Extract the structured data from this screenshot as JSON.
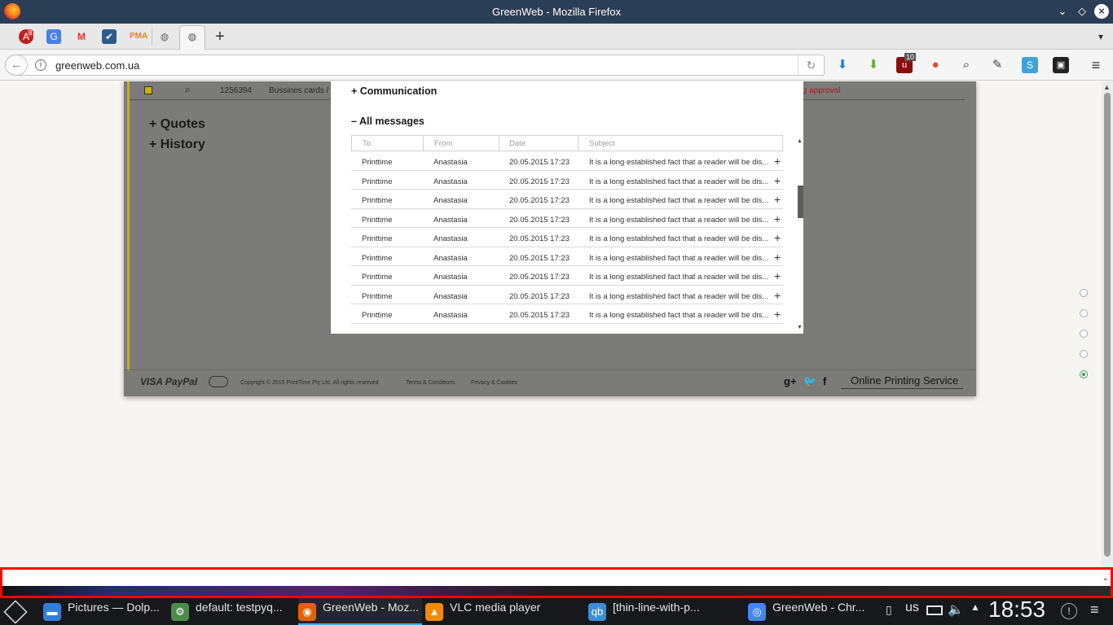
{
  "window": {
    "title": "GreenWeb - Mozilla Firefox"
  },
  "tabbar": {
    "pinned_icons": [
      "adblock-icon",
      "google-translate-icon",
      "gmail-icon",
      "task-icon",
      "pma-icon",
      "globe-icon"
    ],
    "active_tab_icon": "globe-icon",
    "new_tab": "+",
    "overflow": "▾",
    "adblock_badge": "8"
  },
  "navbar": {
    "url": "greenweb.com.ua",
    "ublock_count": "10"
  },
  "background_page": {
    "row": {
      "id": "1256394",
      "product": "Bussines cards /",
      "status": "ing approval"
    },
    "links": [
      "+ Quotes",
      "+ History"
    ],
    "footer": {
      "payments": "VISA  PayPal",
      "copyright": "Copyright © 2015 PrintTime Pty Ltd. All rights reserved",
      "terms": "Terms & Conditions",
      "privacy": "Privacy & Cookies",
      "tagline": "Online Printing Service",
      "social": [
        "g+",
        "twitter",
        "f"
      ]
    }
  },
  "modal": {
    "communication_title": "+ Communication",
    "messages_title": "– All messages",
    "columns": [
      "To",
      "From",
      "Date",
      "Subject"
    ],
    "rows": [
      {
        "to": "Printtime",
        "from": "Anastasia",
        "date": "20.05.2015 17:23",
        "subject": "It is a long established fact that a reader will be dis..."
      },
      {
        "to": "Printtime",
        "from": "Anastasia",
        "date": "20.05.2015 17:23",
        "subject": "It is a long established fact that a reader will be dis..."
      },
      {
        "to": "Printtime",
        "from": "Anastasia",
        "date": "20.05.2015 17:23",
        "subject": "It is a long established fact that a reader will be dis..."
      },
      {
        "to": "Printtime",
        "from": "Anastasia",
        "date": "20.05.2015 17:23",
        "subject": "It is a long established fact that a reader will be dis..."
      },
      {
        "to": "Printtime",
        "from": "Anastasia",
        "date": "20.05.2015 17:23",
        "subject": "It is a long established fact that a reader will be dis..."
      },
      {
        "to": "Printtime",
        "from": "Anastasia",
        "date": "20.05.2015 17:23",
        "subject": "It is a long established fact that a reader will be dis..."
      },
      {
        "to": "Printtime",
        "from": "Anastasia",
        "date": "20.05.2015 17:23",
        "subject": "It is a long established fact that a reader will be dis..."
      },
      {
        "to": "Printtime",
        "from": "Anastasia",
        "date": "20.05.2015 17:23",
        "subject": "It is a long established fact that a reader will be dis..."
      },
      {
        "to": "Printtime",
        "from": "Anastasia",
        "date": "20.05.2015 17:23",
        "subject": "It is a long established fact that a reader will be dis..."
      }
    ],
    "row_action": "+"
  },
  "page_nav_dots": {
    "count": 5,
    "active_index": 4
  },
  "taskbar": {
    "tasks": [
      {
        "name": "task-dolphin",
        "label": "Pictures — Dolp...",
        "icon": "folder-icon",
        "color": "#2f7fd6"
      },
      {
        "name": "task-terminal",
        "label": "default:  testpyq...",
        "icon": "gear-icon",
        "color": "#4c8b4c"
      },
      {
        "name": "task-firefox",
        "label": "GreenWeb - Moz...",
        "icon": "firefox-icon",
        "color": "#e66000",
        "active": true
      },
      {
        "name": "task-vlc",
        "label": "VLC media player",
        "icon": "vlc-icon",
        "color": "#f08a00"
      },
      {
        "name": "task-qbittorrent",
        "label": "[thin-line-with-p...",
        "icon": "qbittorrent-icon",
        "color": "#3b8fd8"
      },
      {
        "name": "task-chrome",
        "label": "GreenWeb - Chr...",
        "icon": "chrome-icon",
        "color": "#4285f4"
      }
    ],
    "keyboard_layout": "us",
    "clock": "18:53"
  },
  "colors": {
    "titlebar": "#2c3e55",
    "overlay": "#7b7b79",
    "accent_yellow": "#c9b100",
    "status_red": "#c0282d",
    "highlight_red": "#ff0000",
    "taskbar": "#16181c"
  }
}
